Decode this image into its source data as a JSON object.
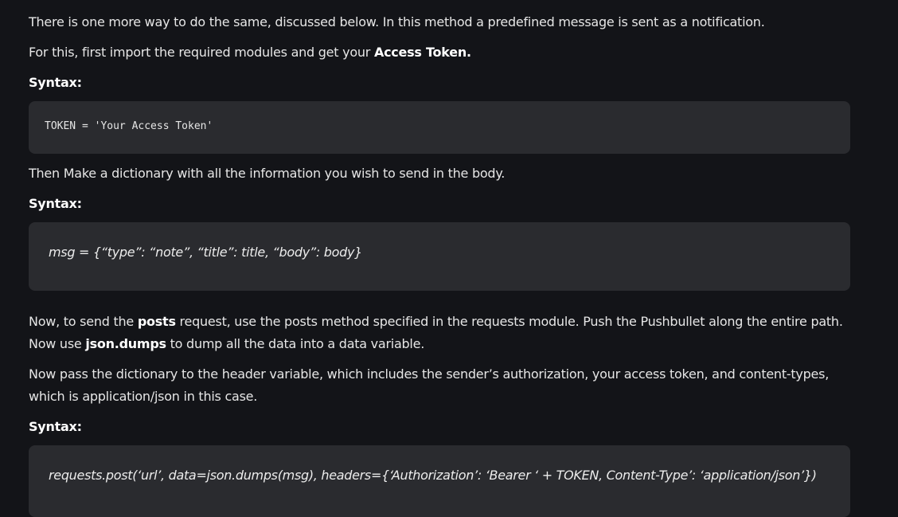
{
  "paragraphs": {
    "p1": "There is one more way to do the same, discussed below. In this method a predefined message is sent as a notification.",
    "p2_before": "For this, first import the required modules and get your ",
    "p2_bold": "Access Token.",
    "p3": "Then Make a dictionary with all the information you wish to send in the body.",
    "p4_a": "Now, to send the ",
    "p4_bold1": "posts",
    "p4_b": " request, use the posts method specified in the requests module. Push the Pushbullet along the entire path. Now use ",
    "p4_bold2": "json.dumps",
    "p4_c": " to dump all the data into a data variable.",
    "p5": "Now pass the dictionary to the header variable, which includes the sender’s authorization, your access token, and content-types, which is application/json in this case."
  },
  "labels": {
    "syntax1": "Syntax:",
    "syntax2": "Syntax:",
    "syntax3": "Syntax:"
  },
  "code": {
    "block1": "TOKEN = 'Your Access Token'",
    "block2": "msg = {“type”: “note”, “title”: title, “body”: body}",
    "block3": "requests.post(‘url’, data=json.dumps(msg), headers={‘Authorization’: ‘Bearer ‘ + TOKEN, Content-Type’: ‘application/json’})"
  },
  "colors": {
    "page_background": "#131418",
    "code_background": "#2a2b2f",
    "text": "#e6e6e6"
  }
}
